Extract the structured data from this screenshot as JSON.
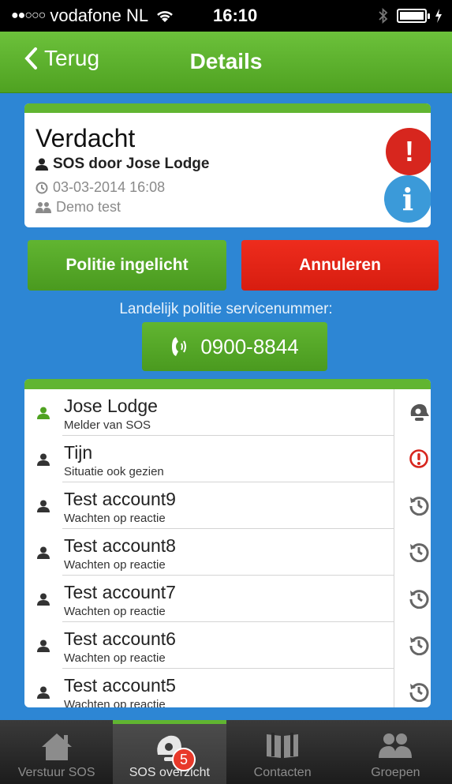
{
  "status_bar": {
    "carrier": "vodafone NL",
    "time": "16:10"
  },
  "nav": {
    "back_label": "Terug",
    "title": "Details"
  },
  "alert": {
    "title": "Verdacht",
    "reported_by": "SOS door Jose Lodge",
    "datetime": "03-03-2014 16:08",
    "group": "Demo test",
    "alert_icon_char": "!",
    "info_icon_char": "i"
  },
  "actions": {
    "police_informed": "Politie ingelicht",
    "cancel": "Annuleren"
  },
  "service": {
    "label": "Landelijk politie servicenummer:",
    "number": "0900-8844"
  },
  "contacts": [
    {
      "name": "Jose Lodge",
      "status": "Melder van SOS",
      "status_icon": "alarm-bell-icon",
      "user_color": "#4fa221"
    },
    {
      "name": "Tijn",
      "status": "Situatie ook gezien",
      "status_icon": "exclamation-circle-icon",
      "user_color": "#333333"
    },
    {
      "name": "Test account9",
      "status": "Wachten op reactie",
      "status_icon": "history-clock-icon",
      "user_color": "#333333"
    },
    {
      "name": "Test account8",
      "status": "Wachten op reactie",
      "status_icon": "history-clock-icon",
      "user_color": "#333333"
    },
    {
      "name": "Test account7",
      "status": "Wachten op reactie",
      "status_icon": "history-clock-icon",
      "user_color": "#333333"
    },
    {
      "name": "Test account6",
      "status": "Wachten op reactie",
      "status_icon": "history-clock-icon",
      "user_color": "#333333"
    },
    {
      "name": "Test account5",
      "status": "Wachten op reactie",
      "status_icon": "history-clock-icon",
      "user_color": "#333333"
    }
  ],
  "tabs": [
    {
      "label": "Verstuur SOS",
      "icon": "home-icon",
      "active": false
    },
    {
      "label": "SOS overzicht",
      "icon": "sos-bell-icon",
      "active": true
    },
    {
      "label": "Contacten",
      "icon": "book-icon",
      "active": false
    },
    {
      "label": "Groepen",
      "icon": "group-icon",
      "active": false
    }
  ],
  "badge_count": "5",
  "colors": {
    "green": "#61b531",
    "red": "#d7261e",
    "blue": "#2d86d4"
  }
}
